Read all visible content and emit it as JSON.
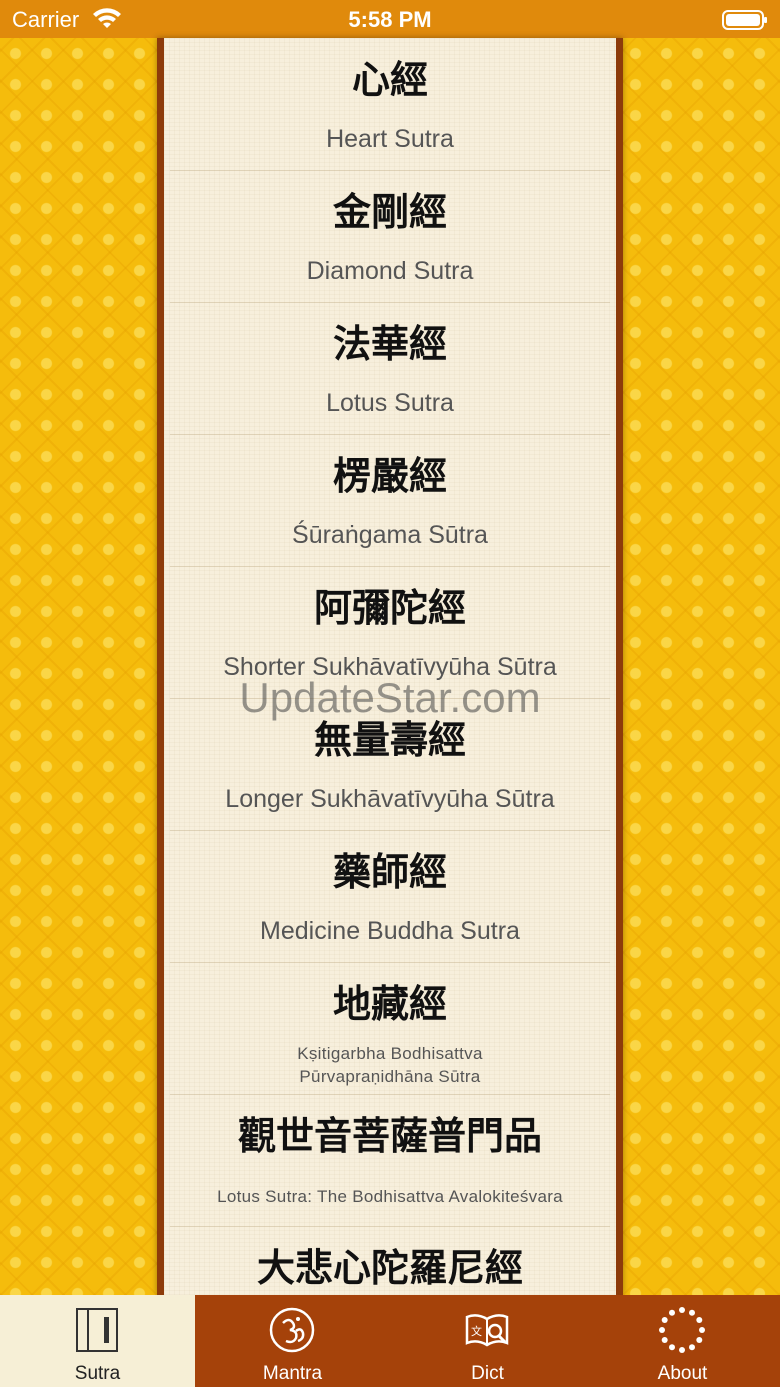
{
  "status_bar": {
    "carrier": "Carrier",
    "time": "5:58 PM"
  },
  "sutras": [
    {
      "chinese": "心經",
      "english": "Heart Sutra"
    },
    {
      "chinese": "金剛經",
      "english": "Diamond Sutra"
    },
    {
      "chinese": "法華經",
      "english": "Lotus Sutra"
    },
    {
      "chinese": "楞嚴經",
      "english": "Śūraṅgama Sūtra"
    },
    {
      "chinese": "阿彌陀經",
      "english": "Shorter Sukhāvatīvyūha Sūtra"
    },
    {
      "chinese": "無量壽經",
      "english": "Longer Sukhāvatīvyūha Sūtra"
    },
    {
      "chinese": "藥師經",
      "english": "Medicine Buddha Sutra"
    },
    {
      "chinese": "地藏經",
      "english_line1": "Kṣitigarbha Bodhisattva",
      "english_line2": "Pūrvapraṇidhāna Sūtra"
    },
    {
      "chinese": "觀世音菩薩普門品",
      "english": "Lotus Sutra: The Bodhisattva Avalokiteśvara"
    },
    {
      "chinese": "大悲心陀羅尼經"
    }
  ],
  "watermark": "UpdateStar.com",
  "tabs": {
    "sutra": "Sutra",
    "mantra": "Mantra",
    "dict": "Dict",
    "about": "About"
  },
  "icons": {
    "sutra_tab": "book-icon",
    "mantra_tab": "om-icon",
    "dict_tab": "dictionary-icon",
    "about_tab": "dotted-circle-icon"
  },
  "colors": {
    "status_bar": "#e08a0c",
    "background_gold": "#f5bc0c",
    "scroll_frame": "#8d3b0a",
    "paper": "#f7efdc",
    "tab_bar": "#a5420a",
    "tab_active": "#f6efd6"
  }
}
